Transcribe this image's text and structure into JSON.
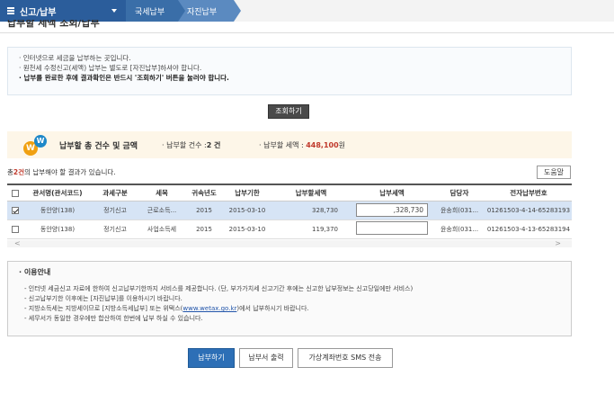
{
  "nav": {
    "menu_label": "신고/납부",
    "breadcrumbs": [
      "국세납부",
      "자진납부"
    ]
  },
  "page_title": "납부할 세액 조회/납부",
  "info": [
    "인터넷으로 세금을 납부하는 곳입니다.",
    "원천세 수정신고(세액) 납부는 별도로 [자진납부]하셔야 합니다.",
    "납부를 완료한 후에 결과확인은 반드시 '조회하기' 버튼을 눌러야 합니다."
  ],
  "query_button": "조회하기",
  "summary": {
    "title": "납부할 총 건수 및 금액",
    "count_label": "납부할 건수 :",
    "count_value": "2 건",
    "amount_label": "납부할 세액 :",
    "amount_value": "448,100",
    "amount_unit": "원"
  },
  "result": {
    "prefix": "총",
    "count": "2건",
    "suffix": "의 납부해야 할 결과가 있습니다."
  },
  "help_button": "도움말",
  "table": {
    "headers": [
      "",
      "관서명(관서코드)",
      "과세구분",
      "세목",
      "귀속년도",
      "납부기한",
      "납부할세액",
      "납부세액",
      "담당자",
      "전자납부번호"
    ],
    "rows": [
      {
        "checked": true,
        "office": "동안양(138)",
        "type": "정기신고",
        "tax": "근로소득...",
        "year": "2015",
        "due": "2015-03-10",
        "amount": "328,730",
        "pay_amount": ",328,730",
        "manager": "윤송희(031...",
        "epay_no": "01261503-4-14-65283193"
      },
      {
        "checked": false,
        "office": "동안양(138)",
        "type": "정기신고",
        "tax": "사업소득세",
        "year": "2015",
        "due": "2015-03-10",
        "amount": "119,370",
        "pay_amount": "",
        "manager": "윤송희(031...",
        "epay_no": "01261503-4-13-65283194"
      }
    ]
  },
  "notice": {
    "title": "· 이용안내",
    "items": [
      "인터넷 세금신고 자료에 한하여 신고납부기한까지 서비스를 제공합니다. (단, 부가가치세 신고기간 후에는 신고한 납부정보는 신고당일에만 서비스)",
      "신고납부기한 이후에는 [자진납부]를 이용하시기 바랍니다.",
      "세무서가 동일한 경우에만 합산하여 한번에 납부 하실 수 있습니다."
    ],
    "local_tax_pre": "지방소득세는 지방세이므로 [지방소득세납부] 또는 위택스(",
    "local_tax_link": "www.wetax.go.kr",
    "local_tax_post": ")에서 납부하시기 바랍니다."
  },
  "buttons": {
    "pay": "납부하기",
    "print": "납부서 출력",
    "sms": "가상계좌번호 SMS 전송"
  },
  "colors": {
    "nav_blue": "#2b5d9b",
    "pay_blue": "#2d6fb6",
    "amount_red": "#c0392b",
    "selected_row": "#d6e4f5"
  }
}
